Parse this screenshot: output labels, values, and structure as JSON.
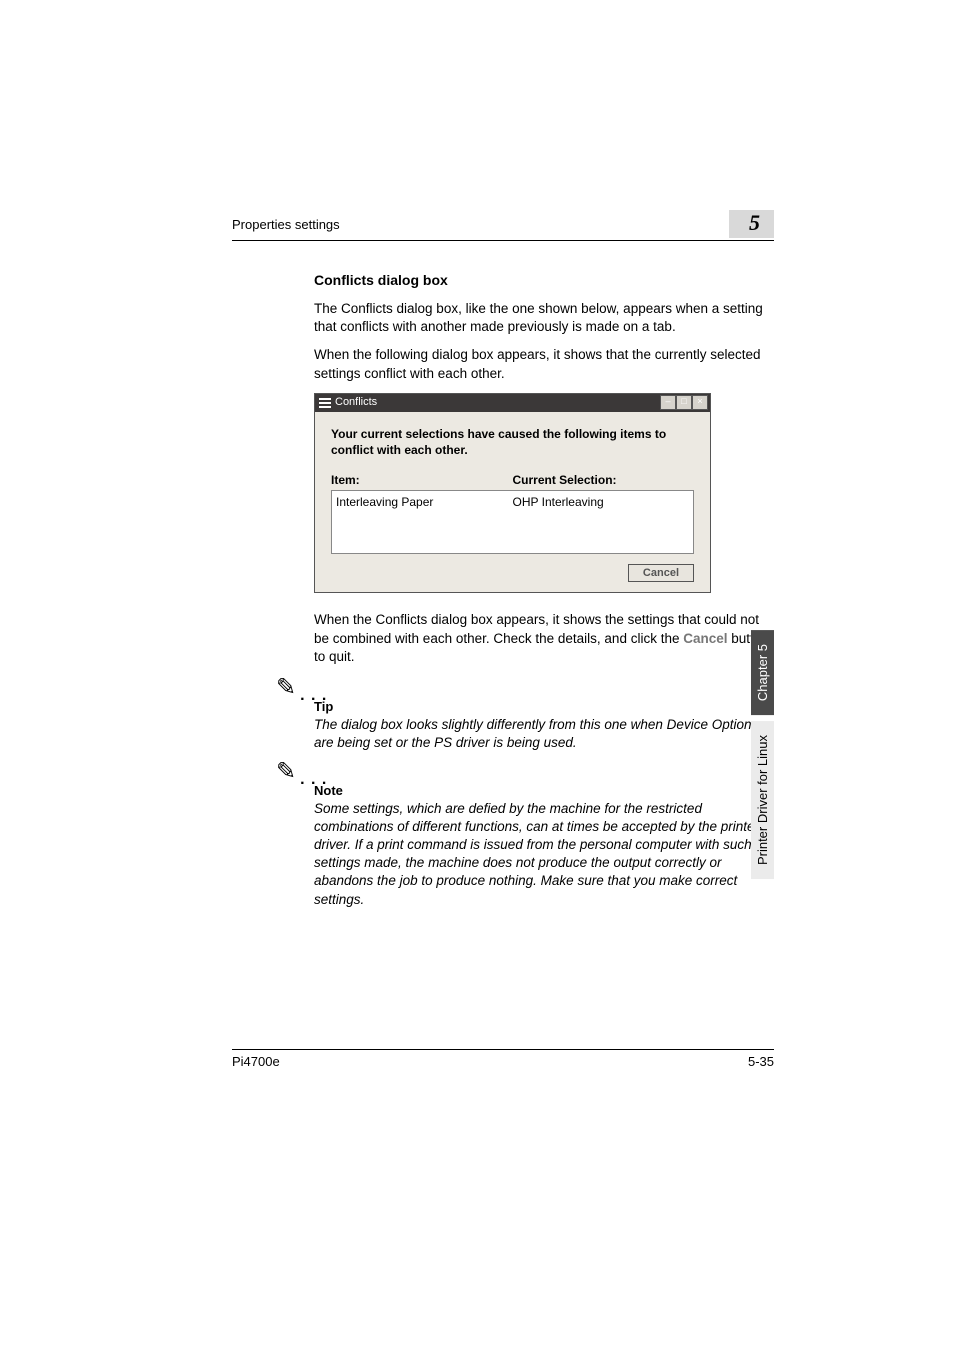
{
  "header": {
    "section": "Properties settings",
    "chapter_num": "5"
  },
  "body": {
    "title": "Conflicts dialog box",
    "p1": "The Conflicts dialog box, like the one shown below, appears when a setting that conflicts with another made previously is made on a tab.",
    "p2": "When the following dialog box appears, it shows that the currently selected settings conflict with each other.",
    "p3a": "When the Conflicts dialog box appears, it shows the settings that could not be combined with each other. Check the details, and click the ",
    "p3b": "Cancel",
    "p3c": " button to quit."
  },
  "dialog": {
    "title": "Conflicts",
    "message": "Your current selections have caused the following items to conflict with each other.",
    "col1_header": "Item:",
    "col2_header": "Current Selection:",
    "col1_value": "Interleaving Paper",
    "col2_value": "OHP Interleaving",
    "cancel": "Cancel"
  },
  "tip": {
    "label": "Tip",
    "text": "The dialog box looks slightly differently from this one when Device Options are being set or the PS driver is being used."
  },
  "note": {
    "label": "Note",
    "text": "Some settings, which are defied by the machine for the restricted combinations of different functions, can at times be accepted by the printer driver. If a print command is issued from the personal computer with such settings made, the machine does not produce the output correctly or abandons the job to produce nothing. Make sure that you make correct settings."
  },
  "sidebar": {
    "tab1": "Chapter 5",
    "tab2": "Printer Driver for Linux"
  },
  "footer": {
    "left": "Pi4700e",
    "right": "5-35"
  }
}
